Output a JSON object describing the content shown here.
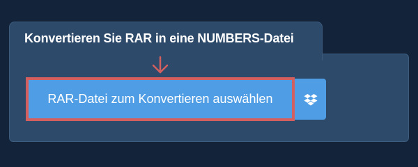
{
  "converter": {
    "title": "Konvertieren Sie RAR in eine NUMBERS-Datei",
    "select_button_label": "RAR-Datei zum Konvertieren auswählen"
  },
  "icons": {
    "pointer": "arrow-down-icon",
    "cloud_source": "dropbox-icon"
  },
  "colors": {
    "page_background": "#13243a",
    "panel": "#2d4a6a",
    "button": "#4f9de4",
    "highlight": "#d45f5f",
    "text": "#ffffff"
  }
}
